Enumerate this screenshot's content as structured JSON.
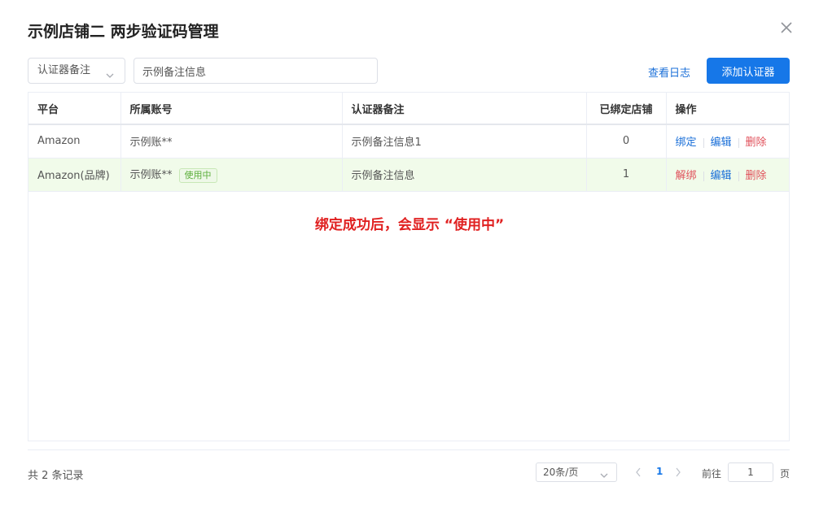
{
  "dialog": {
    "title": "示例店铺二 两步验证码管理"
  },
  "toolbar": {
    "filter_select_value": "认证器备注",
    "search_value": "示例备注信息",
    "log_link": "查看日志",
    "add_button": "添加认证器"
  },
  "table": {
    "headers": {
      "platform": "平台",
      "account": "所属账号",
      "note": "认证器备注",
      "bound_count": "已绑定店铺",
      "actions": "操作"
    },
    "rows": [
      {
        "platform": "Amazon",
        "account": "示例账**",
        "tag": "",
        "note": "示例备注信息1",
        "bound_count": "0",
        "action_primary": "绑定",
        "action_edit": "编辑",
        "action_delete": "删除"
      },
      {
        "platform": "Amazon(品牌)",
        "account": "示例账**",
        "tag": "使用中",
        "note": "示例备注信息",
        "bound_count": "1",
        "action_primary": "解绑",
        "action_edit": "编辑",
        "action_delete": "删除"
      }
    ]
  },
  "annotation": "绑定成功后，会显示 “使用中”",
  "pagination": {
    "total_text": "共 2 条记录",
    "page_size": "20条/页",
    "current_page": "1",
    "goto_label": "前往",
    "goto_value": "1",
    "goto_suffix": "页"
  },
  "colors": {
    "primary": "#1677e8",
    "danger": "#e0505a",
    "success_tag": "#5bae3a",
    "active_row": "#f1fbea",
    "annotation": "#e02020"
  }
}
